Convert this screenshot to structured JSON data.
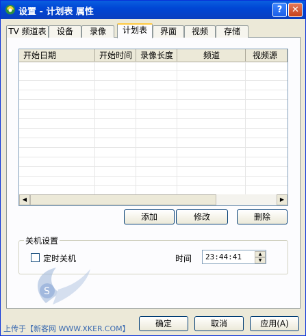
{
  "window": {
    "title": "设置 - 计划表 属性",
    "help_glyph": "?",
    "close_glyph": "✕"
  },
  "tabs": [
    {
      "label": "TV 频道表"
    },
    {
      "label": "设备"
    },
    {
      "label": "录像"
    },
    {
      "label": "计划表",
      "active": true
    },
    {
      "label": "界面"
    },
    {
      "label": "视频"
    },
    {
      "label": "存储"
    }
  ],
  "schedule": {
    "columns": [
      "开始日期",
      "开始时间",
      "录像长度",
      "频道",
      "视频源"
    ],
    "rows": [],
    "scroll_left_glyph": "◀",
    "scroll_right_glyph": "▶"
  },
  "actions": {
    "add": "添加",
    "edit": "修改",
    "delete": "删除"
  },
  "shutdown": {
    "group_title": "关机设置",
    "timed_label": "定时关机",
    "timed_checked": false,
    "time_label": "时间",
    "time_value": "23:44:41",
    "spin_up_glyph": "▲",
    "spin_down_glyph": "▼"
  },
  "footer": {
    "ok": "确定",
    "cancel": "取消",
    "apply": "应用(A)"
  },
  "watermark": {
    "text": "上传于【新客网 WWW.XKER.COM】"
  },
  "colors": {
    "titlebar": "#0a4fd8",
    "dialog_bg": "#ece9d8",
    "active_tab_accent": "#ffc83c"
  }
}
